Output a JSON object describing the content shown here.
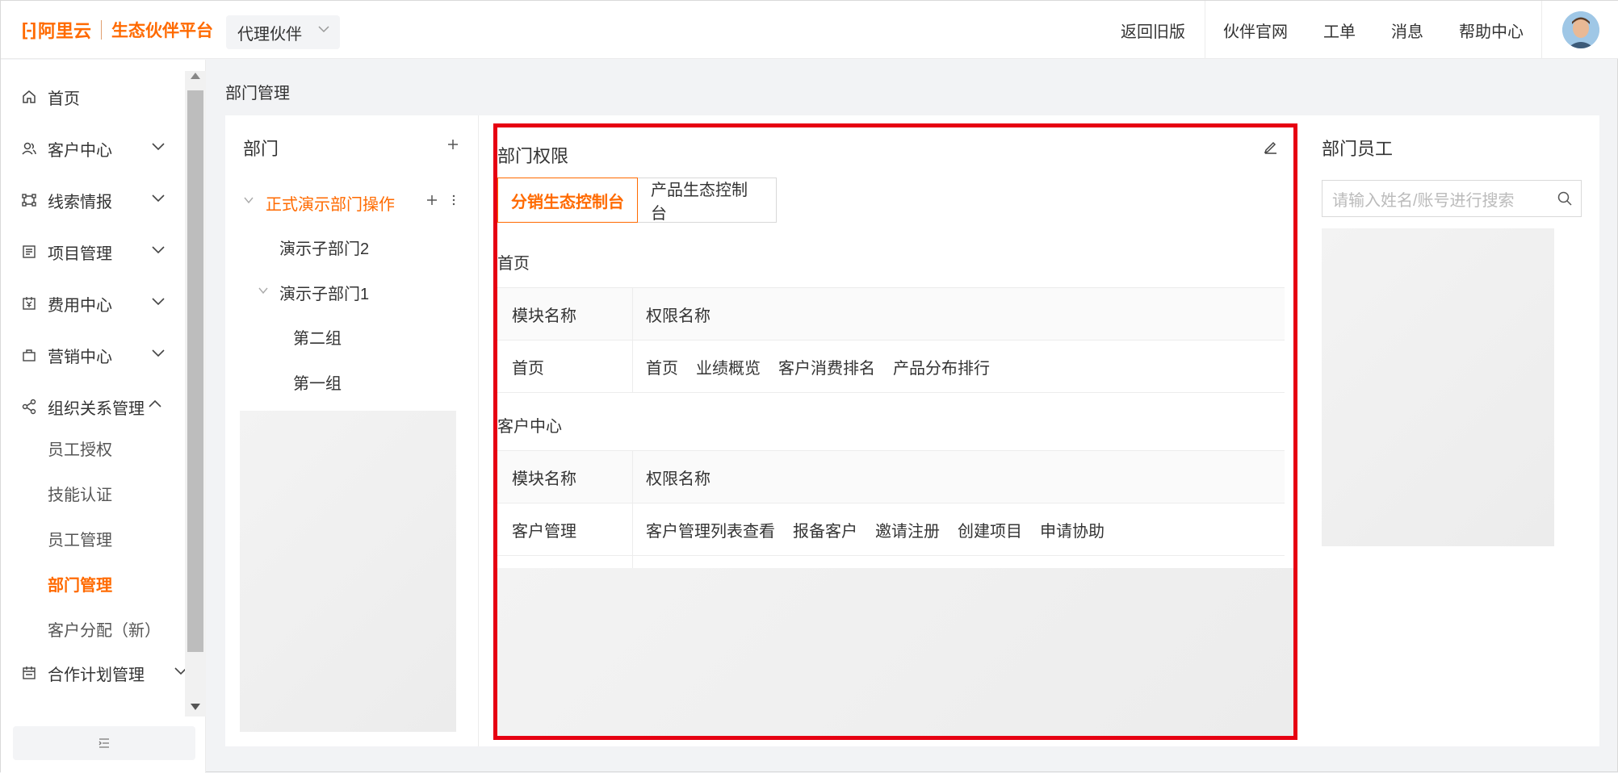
{
  "header": {
    "brand": "阿里云",
    "brand_sub": "生态伙伴平台",
    "agent_select": "代理伙伴",
    "nav": [
      "返回旧版",
      "伙伴官网",
      "工单",
      "消息",
      "帮助中心"
    ]
  },
  "sidebar": {
    "items": [
      {
        "label": "首页",
        "icon": "home-icon"
      },
      {
        "label": "客户中心",
        "icon": "users-icon"
      },
      {
        "label": "线索情报",
        "icon": "nodes-icon"
      },
      {
        "label": "项目管理",
        "icon": "list-icon"
      },
      {
        "label": "费用中心",
        "icon": "calendar-yen-icon"
      },
      {
        "label": "营销中心",
        "icon": "bag-icon"
      },
      {
        "label": "组织关系管理",
        "icon": "share-icon"
      },
      {
        "label": "合作计划管理",
        "icon": "calendar-icon"
      }
    ],
    "sub_items": [
      "员工授权",
      "技能认证",
      "员工管理",
      "部门管理",
      "客户分配（新）"
    ]
  },
  "breadcrumb": "部门管理",
  "dept": {
    "title": "部门",
    "tree": [
      {
        "label": "正式演示部门操作"
      },
      {
        "label": "演示子部门2"
      },
      {
        "label": "演示子部门1"
      },
      {
        "label": "第二组"
      },
      {
        "label": "第一组"
      }
    ]
  },
  "perm": {
    "title": "部门权限",
    "tabs": [
      "分销生态控制台",
      "产品生态控制台"
    ],
    "sections": [
      {
        "title": "首页",
        "header": [
          "模块名称",
          "权限名称"
        ],
        "rows": [
          {
            "module": "首页",
            "perms": [
              "首页",
              "业绩概览",
              "客户消费排名",
              "产品分布排行"
            ]
          }
        ]
      },
      {
        "title": "客户中心",
        "header": [
          "模块名称",
          "权限名称"
        ],
        "rows": [
          {
            "module": "客户管理",
            "perms": [
              "客户管理列表查看",
              "报备客户",
              "邀请注册",
              "创建项目",
              "申请协助"
            ]
          }
        ]
      }
    ]
  },
  "staff": {
    "title": "部门员工",
    "search_placeholder": "请输入姓名/账号进行搜索"
  },
  "colors": {
    "accent": "#ff6a00",
    "highlight_border": "#e60012"
  }
}
